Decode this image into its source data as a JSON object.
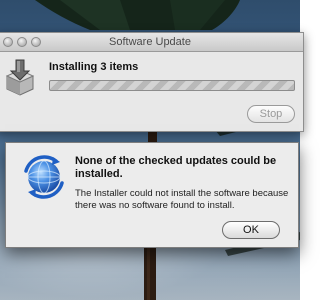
{
  "window": {
    "title": "Software Update",
    "status_label": "Installing 3 items",
    "stop_label": "Stop"
  },
  "alert": {
    "heading": "None of the checked updates could be installed.",
    "message": "The Installer could not install the software because there was no software found to install.",
    "ok_label": "OK"
  },
  "icons": {
    "installer": "installer-box-icon",
    "alert": "software-update-globe-icon"
  },
  "colors": {
    "window_bg": "#e8e8e8",
    "alert_bg": "#ececec",
    "globe_blue": "#2f6fd0"
  }
}
